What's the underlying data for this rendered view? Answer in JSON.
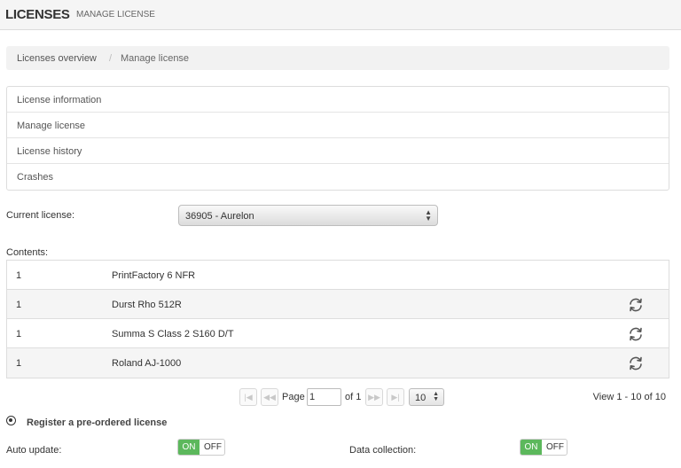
{
  "header": {
    "title": "LICENSES",
    "subtitle": "MANAGE LICENSE"
  },
  "breadcrumb": {
    "items": [
      "Licenses overview",
      "Manage license"
    ],
    "separator": "/"
  },
  "nav": {
    "items": [
      "License information",
      "Manage license",
      "License history",
      "Crashes"
    ]
  },
  "current_license": {
    "label": "Current license:",
    "value": "36905 - Aurelon"
  },
  "contents": {
    "label": "Contents:",
    "rows": [
      {
        "qty": "1",
        "name": "PrintFactory 6 NFR",
        "refresh": false
      },
      {
        "qty": "1",
        "name": "Durst Rho 512R",
        "refresh": true
      },
      {
        "qty": "1",
        "name": "Summa S Class 2 S160 D/T",
        "refresh": true
      },
      {
        "qty": "1",
        "name": "Roland AJ-1000",
        "refresh": true
      }
    ]
  },
  "pager": {
    "page_label": "Page",
    "page_value": "1",
    "of_label": "of 1",
    "per_page": "10",
    "view_label": "View 1 - 10 of 10"
  },
  "register": {
    "label": "Register a pre-ordered license"
  },
  "auto_update": {
    "label": "Auto update:",
    "on": "ON",
    "off": "OFF",
    "state": "on"
  },
  "data_collection": {
    "label": "Data collection:",
    "on": "ON",
    "off": "OFF",
    "state": "on"
  },
  "colors": {
    "toggle_on": "#5cb85c",
    "breadcrumb_bg": "#f2f2f2",
    "row_alt": "#f5f5f5"
  }
}
